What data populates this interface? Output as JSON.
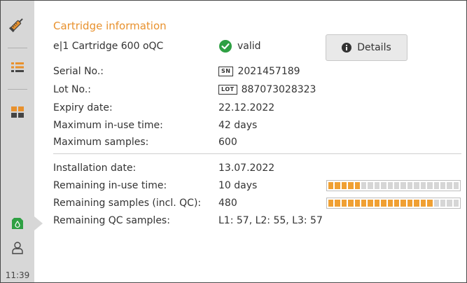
{
  "sidebar": {
    "time": "11:39",
    "icons": [
      "syringe-icon",
      "list-icon",
      "dashboard-icon",
      "cartridge-status-icon",
      "user-icon"
    ],
    "colors": {
      "accent": "#e8912d",
      "active_status": "#2ea043"
    }
  },
  "header": {
    "title": "Cartridge information",
    "cartridge_name": "e|1 Cartridge 600 oQC",
    "status": "valid",
    "details_label": "Details"
  },
  "info": {
    "serial_label": "Serial No.:",
    "serial_tag": "SN",
    "serial_value": "2021457189",
    "lot_label": "Lot No.:",
    "lot_tag": "LOT",
    "lot_value": "887073028323",
    "expiry_label": "Expiry date:",
    "expiry_value": "22.12.2022",
    "max_time_label": "Maximum in-use time:",
    "max_time_value": "42 days",
    "max_samples_label": "Maximum samples:",
    "max_samples_value": "600"
  },
  "usage": {
    "install_label": "Installation date:",
    "install_value": "13.07.2022",
    "remaining_time_label": "Remaining in-use time:",
    "remaining_time_value": "10 days",
    "remaining_time_fraction": 0.25,
    "remaining_samples_label": "Remaining samples (incl. QC):",
    "remaining_samples_value": "480",
    "remaining_samples_fraction": 0.8,
    "remaining_qc_label": "Remaining QC samples:",
    "remaining_qc_value": "L1: 57, L2: 55, L3: 57"
  }
}
